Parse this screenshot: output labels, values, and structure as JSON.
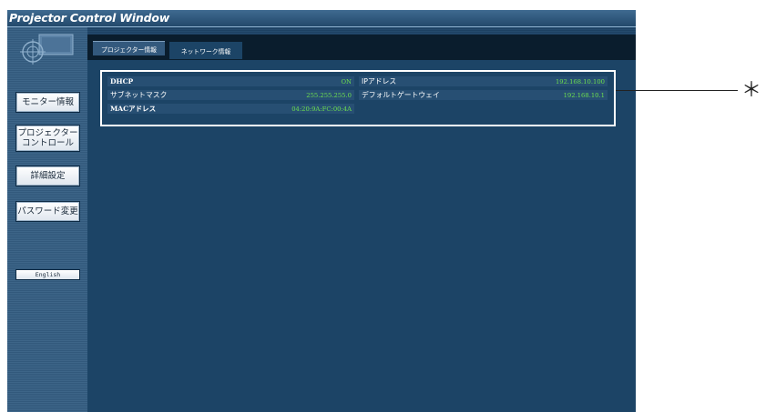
{
  "window": {
    "title": "Projector Control Window"
  },
  "sidebar": {
    "logo_icon": "globe-logo-icon",
    "buttons": [
      {
        "label": "モニター情報"
      },
      {
        "label": "プロジェクター\nコントロール"
      },
      {
        "label": "詳細設定"
      },
      {
        "label": "パスワード変更"
      }
    ],
    "language_button": "English"
  },
  "tabs": [
    {
      "label": "プロジェクター情報",
      "active": false
    },
    {
      "label": "ネットワーク情報",
      "active": true
    }
  ],
  "network_info": {
    "dhcp": {
      "label": "DHCP",
      "value": "ON"
    },
    "ip_address": {
      "label": "IPアドレス",
      "value": "192.168.10.100"
    },
    "subnet_mask": {
      "label": "サブネットマスク",
      "value": "255.255.255.0"
    },
    "default_gateway": {
      "label": "デフォルトゲートウェイ",
      "value": "192.168.10.1"
    },
    "mac_address": {
      "label": "MACアドレス",
      "value": "04:20:9A:FC:00:4A"
    }
  },
  "annotation": {
    "mark": "＊"
  },
  "colors": {
    "background": "#1c4466",
    "sidebar": "#3d6588",
    "value_text": "#6ee04f",
    "highlight_border": "#ffffff"
  }
}
